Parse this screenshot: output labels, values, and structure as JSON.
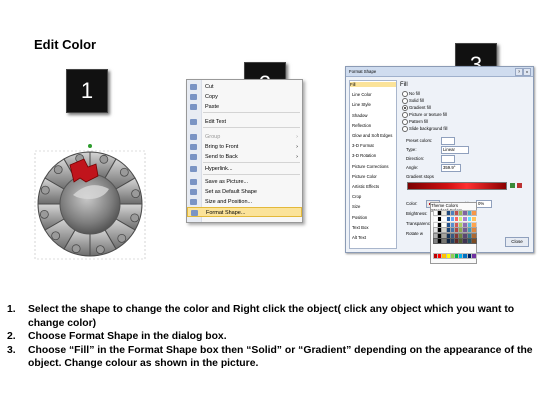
{
  "title": "Edit Color",
  "badges": [
    "1",
    "2",
    "3"
  ],
  "context_menu": {
    "items": [
      {
        "label": "Cut",
        "state": "enabled"
      },
      {
        "label": "Copy",
        "state": "enabled"
      },
      {
        "label": "Paste",
        "state": "enabled"
      },
      {
        "label": "Edit Text",
        "state": "enabled"
      },
      {
        "label": "Group",
        "state": "disabled",
        "submenu": true
      },
      {
        "label": "Bring to Front",
        "state": "enabled",
        "submenu": true
      },
      {
        "label": "Send to Back",
        "state": "enabled",
        "submenu": true
      },
      {
        "label": "Hyperlink...",
        "state": "enabled"
      },
      {
        "label": "Save as Picture...",
        "state": "enabled"
      },
      {
        "label": "Set as Default Shape",
        "state": "enabled"
      },
      {
        "label": "Size and Position...",
        "state": "enabled"
      },
      {
        "label": "Format Shape...",
        "state": "highlighted"
      }
    ],
    "submenu_arrow": "›"
  },
  "format_dialog": {
    "title": "Format Shape",
    "help_btn": "?",
    "close_btn": "x",
    "nav": [
      "Fill",
      "Line Color",
      "Line Style",
      "Shadow",
      "Reflection",
      "Glow and Soft Edges",
      "3-D Format",
      "3-D Rotation",
      "Picture Corrections",
      "Picture Color",
      "Artistic Effects",
      "Crop",
      "Size",
      "Position",
      "Text Box",
      "Alt Text"
    ],
    "selected_nav": "Fill",
    "heading": "Fill",
    "options": [
      "No fill",
      "Solid fill",
      "Gradient fill",
      "Picture or texture fill",
      "Pattern fill",
      "Slide background fill"
    ],
    "selected_option": "Gradient fill",
    "preset_colors_label": "Preset colors:",
    "type_label": "Type:",
    "type_value": "Linear",
    "direction_label": "Direction:",
    "angle_label": "Angle:",
    "angle_value": "359.9°",
    "gradient_stops_label": "Gradient stops",
    "color_label": "Color:",
    "position_label": "Position:",
    "position_value": "0%",
    "brightness_label": "Brightness:",
    "transparency_label": "Transparency:",
    "rotate_label": "Rotate w",
    "theme_colors_label": "Theme Colors",
    "standard_colors_label": "Standard Colors",
    "close_label": "Close"
  },
  "steps": [
    {
      "num": "1.",
      "text": "Select the shape to change the color and Right click the object( click any object which you want to change color)"
    },
    {
      "num": "2.",
      "text": "Choose Format Shape in the dialog box."
    },
    {
      "num": "3.",
      "text": "Choose “Fill” in the Format Shape box then “Solid” or “Gradient” depending on the appearance of the object. Change colour as shown in the picture."
    }
  ],
  "colors": {
    "accent_red": "#c0141c",
    "puzzle_grey": "#8a8a8a",
    "highlight": "#fbe39a",
    "badge_bg": "#111111"
  },
  "icons": [
    "cut-icon",
    "copy-icon",
    "paste-icon",
    "edit-text-icon",
    "group-icon",
    "bring-front-icon",
    "send-back-icon",
    "hyperlink-icon",
    "save-picture-icon",
    "default-shape-icon",
    "size-position-icon",
    "format-shape-icon"
  ]
}
